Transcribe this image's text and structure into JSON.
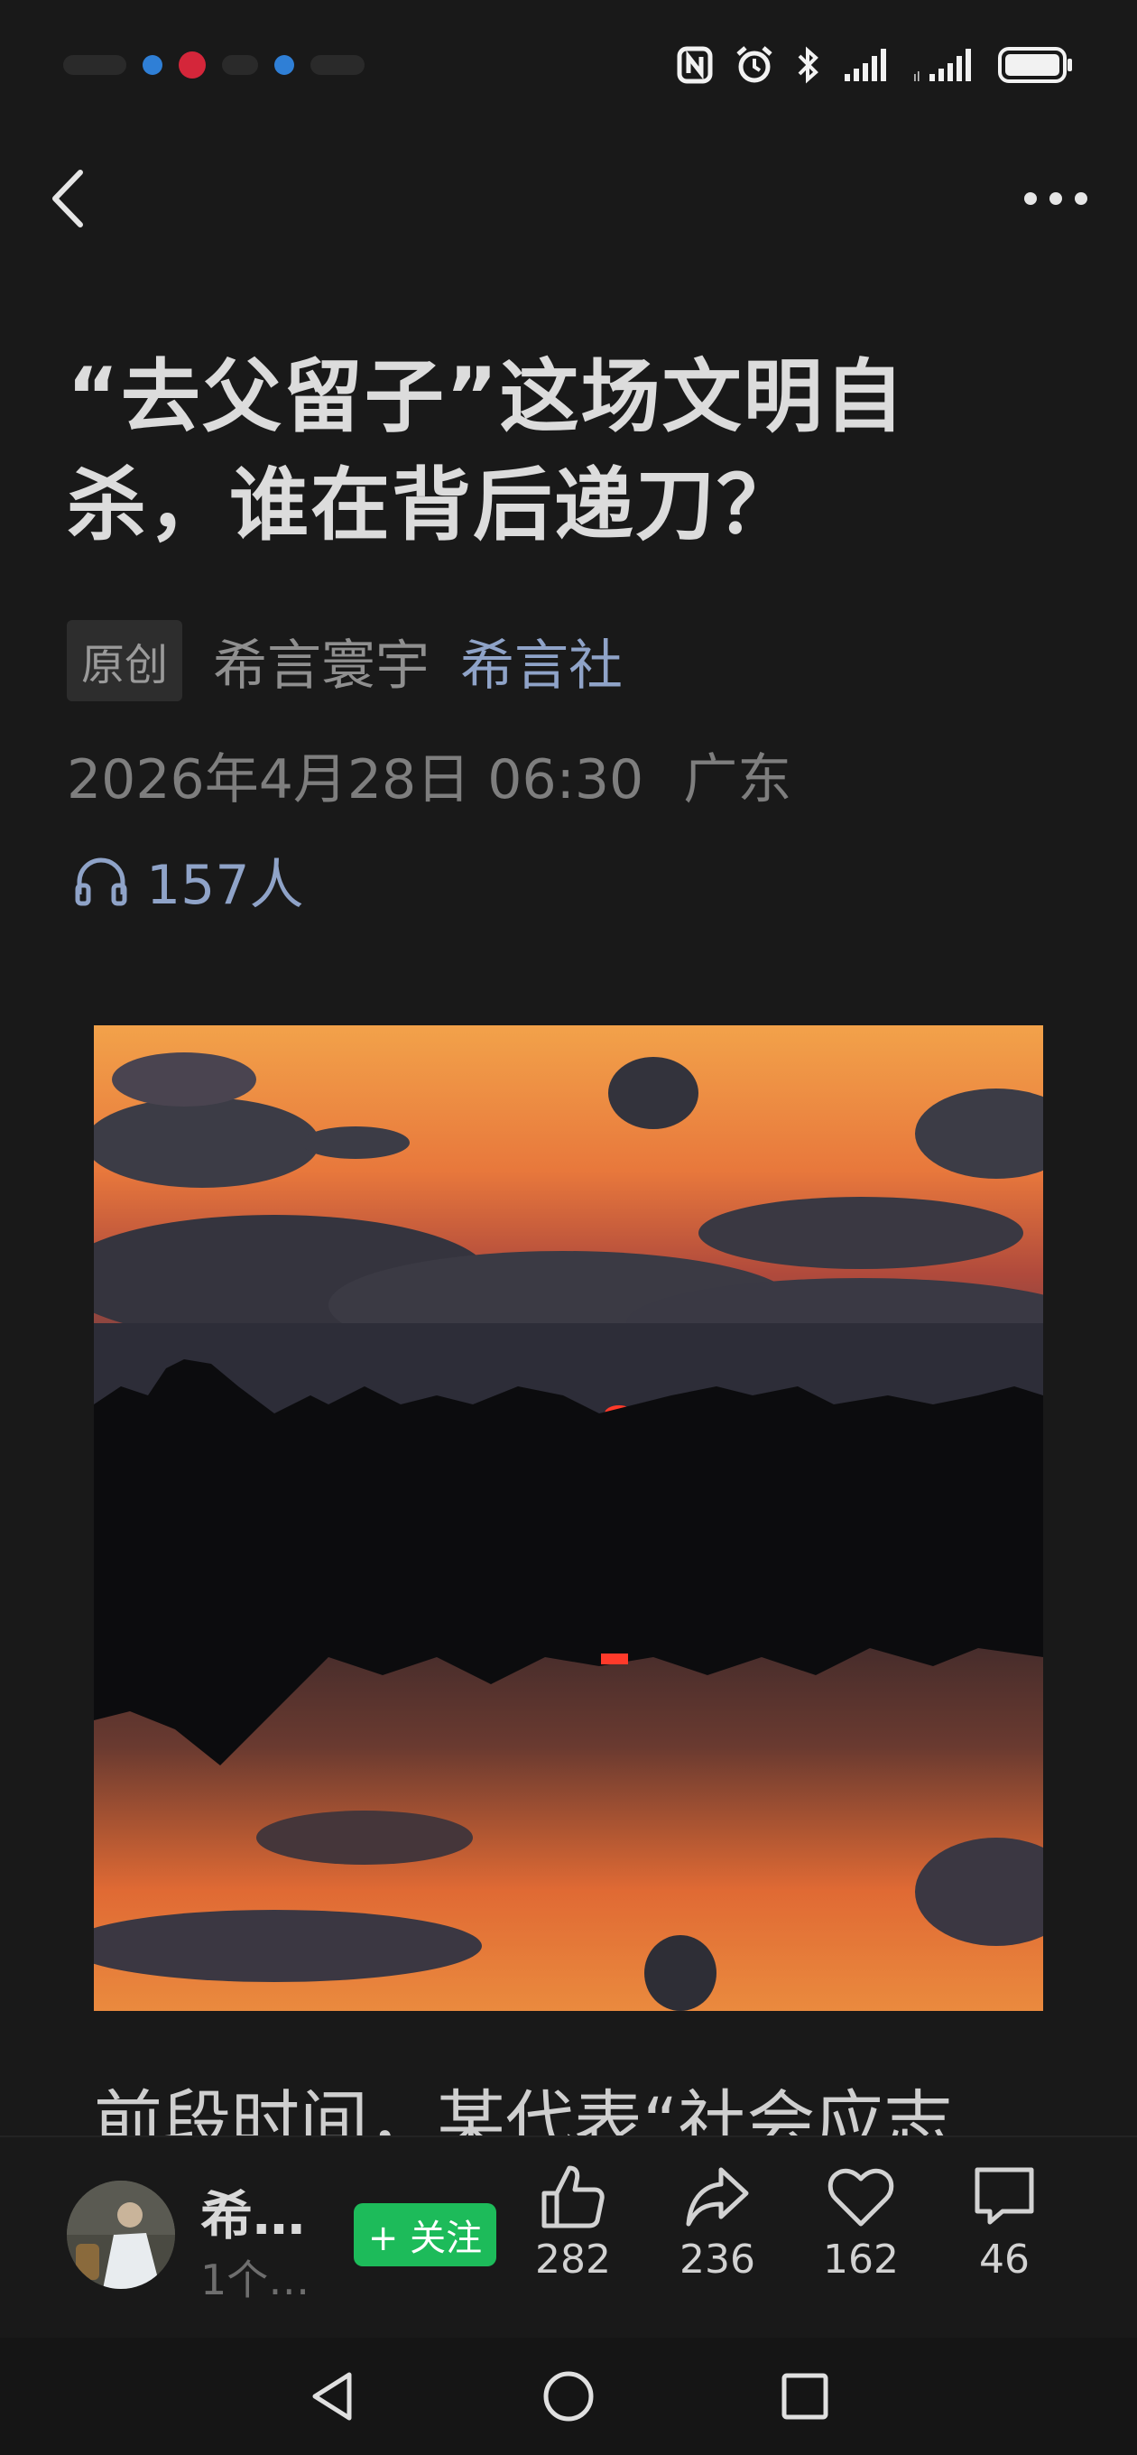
{
  "article": {
    "title_line1": "“去父留子”这场文明自",
    "title_line2": "杀，谁在背后递刀？",
    "original_tag": "原创",
    "author": "希言寰宇",
    "account": "希言社",
    "date": "2026年4月28日 06:30",
    "location": "广东",
    "listeners": "157人",
    "paragraph_peek": "前段时间，某代表“社会应志"
  },
  "bottom_bar": {
    "author_name": "希…",
    "author_sub": "1个…",
    "follow_label": "+ 关注",
    "likes": "282",
    "shares": "236",
    "favorites": "162",
    "comments": "46"
  },
  "colors": {
    "background": "#191919",
    "link_blue": "#8fa3c8",
    "follow_green": "#1dbb5a"
  },
  "icons": [
    "back-icon",
    "more-icon",
    "headphones-icon",
    "thumbs-up-icon",
    "share-icon",
    "heart-icon",
    "comment-icon",
    "nav-back-icon",
    "nav-home-icon",
    "nav-recents-icon"
  ]
}
